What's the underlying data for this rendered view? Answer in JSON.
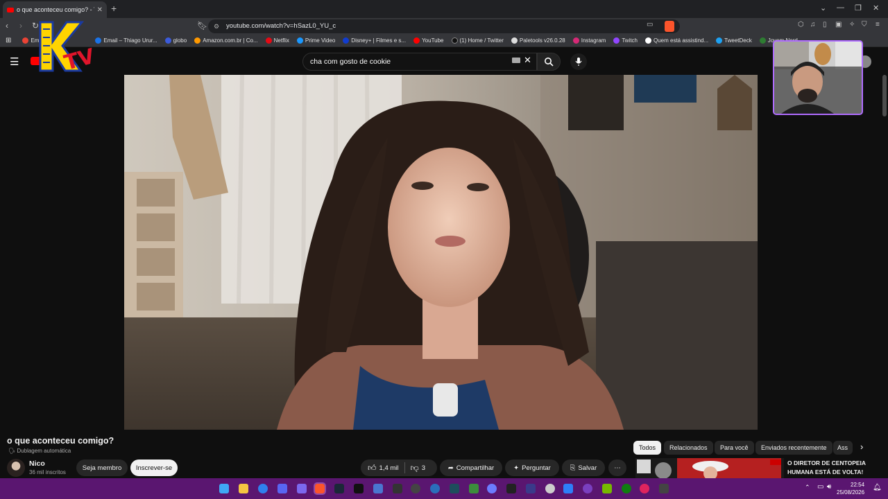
{
  "browser": {
    "tab_title": "o que aconteceu comigo? - Y",
    "url": "youtube.com/watch?v=hSazL0_YU_c",
    "bookmarks": [
      {
        "label": "Em",
        "color": "#ea4335"
      },
      {
        "label": "Email – Thiago Urur...",
        "color": "#1a73e8"
      },
      {
        "label": "globo",
        "color": "#3b5bdb"
      },
      {
        "label": "Amazon.com.br | Co...",
        "color": "#ff9900"
      },
      {
        "label": "Netflix",
        "color": "#e50914"
      },
      {
        "label": "Prime Video",
        "color": "#1a98ff"
      },
      {
        "label": "Disney+ | Filmes e s...",
        "color": "#113ccf"
      },
      {
        "label": "YouTube",
        "color": "#ff0000"
      },
      {
        "label": "(1) Home / Twitter",
        "color": "#222222"
      },
      {
        "label": "Paletools v26.0.28",
        "color": "#dddddd"
      },
      {
        "label": "Instagram",
        "color": "#d62976"
      },
      {
        "label": "Twitch",
        "color": "#9146ff"
      },
      {
        "label": "Quem está assistind...",
        "color": "#ffffff"
      },
      {
        "label": "TweetDeck",
        "color": "#1da1f2"
      },
      {
        "label": "Jovem Nerd -",
        "color": "#2e7d32"
      }
    ]
  },
  "youtube": {
    "search_query": "cha com gosto de cookie",
    "video_title": "o que aconteceu comigo?",
    "dub_label": "Dublagem automática",
    "channel_name": "Nico",
    "channel_subs": "36 mil inscritos",
    "member_label": "Seja membro",
    "subscribe_label": "Inscrever-se",
    "like_count": "1,4 mil",
    "dislike_count": "3",
    "share_label": "Compartilhar",
    "ask_label": "Perguntar",
    "save_label": "Salvar",
    "chips": [
      "Todos",
      "Relacionados",
      "Para você",
      "Enviados recentemente",
      "Ass"
    ],
    "rec_title_line1": "O DIRETOR DE CENTOPEIA",
    "rec_title_line2": "HUMANA ESTÁ DE VOLTA!"
  },
  "overlay": {
    "logo_text": "KTV"
  },
  "taskbar": {
    "time": "22:54",
    "date": "25/08/2026"
  },
  "colors": {
    "taskbar": "#5a1670",
    "webcam_border": "#b06cff",
    "youtube_red": "#ff0000"
  }
}
